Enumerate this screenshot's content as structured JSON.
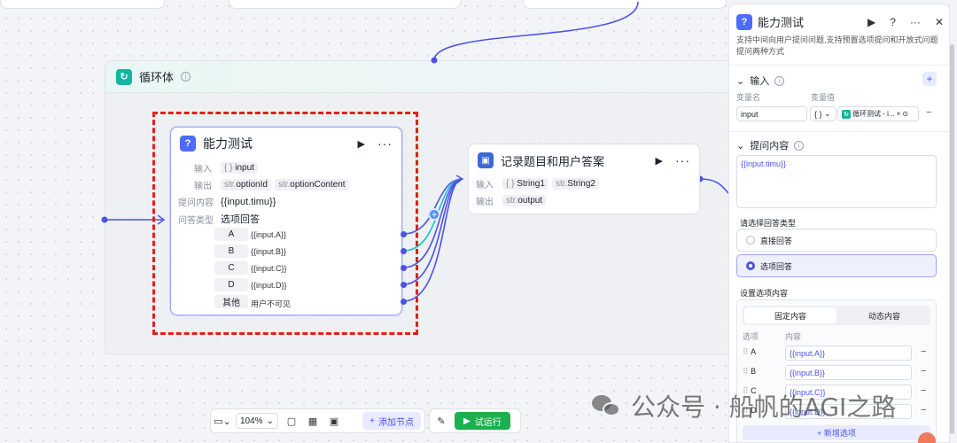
{
  "loop": {
    "title": "循环体"
  },
  "node_ask": {
    "title": "能力测试",
    "input_label": "输入",
    "input_tag_type": "{ }",
    "input_tag_name": "input",
    "output_label": "输出",
    "outputs": [
      {
        "type": "str.",
        "name": "optionId"
      },
      {
        "type": "str.",
        "name": "optionContent"
      }
    ],
    "question_label": "提问内容",
    "question_value": "{{input.timu}}",
    "answer_type_label": "问答类型",
    "answer_type_value": "选项回答",
    "options": [
      {
        "key": "A",
        "value": "{{input.A}}"
      },
      {
        "key": "B",
        "value": "{{input.B}}"
      },
      {
        "key": "C",
        "value": "{{input.C}}"
      },
      {
        "key": "D",
        "value": "{{input.D}}"
      },
      {
        "key": "其他",
        "value": "用户不可见"
      }
    ]
  },
  "node_record": {
    "title": "记录题目和用户答案",
    "input_label": "输入",
    "inputs": [
      {
        "type": "{ }",
        "name": "String1"
      },
      {
        "type": "str.",
        "name": "String2"
      }
    ],
    "output_label": "输出",
    "output_type": "str.",
    "output_name": "output"
  },
  "panel": {
    "title": "能力测试",
    "description": "支持中间向用户提问问题,支持预置选项提问和开放式问题提问两种方式",
    "input_section": "输入",
    "col_var_name": "变量名",
    "col_var_value": "变量值",
    "var_name": "input",
    "var_type": "{ }",
    "var_ref": "循环测试 - i...",
    "question_section": "提问内容",
    "question_text": "{{input.timu}}",
    "answer_type_title": "请选择回答类型",
    "answer_types": [
      "直接回答",
      "选项回答"
    ],
    "selected_answer_type": "选项回答",
    "options_title": "设置选项内容",
    "tabs": [
      "固定内容",
      "动态内容"
    ],
    "col_option": "选项",
    "col_content": "内容",
    "option_rows": [
      {
        "key": "A",
        "value": "{{input.A}}"
      },
      {
        "key": "B",
        "value": "{{input.B}}"
      },
      {
        "key": "C",
        "value": "{{input.C}}"
      },
      {
        "key": "D",
        "value": "{{input.D}}"
      }
    ],
    "add_option": "新增选项"
  },
  "toolbar": {
    "zoom": "104%",
    "add_node": "添加节点",
    "run": "试运行"
  },
  "watermark": {
    "text": "公众号 · 船帆的AGI之路"
  },
  "colors": {
    "accent": "#4d53e6",
    "loop_teal": "#12b5a0",
    "run_green": "#1db04f",
    "highlight_red": "#e0201c"
  }
}
